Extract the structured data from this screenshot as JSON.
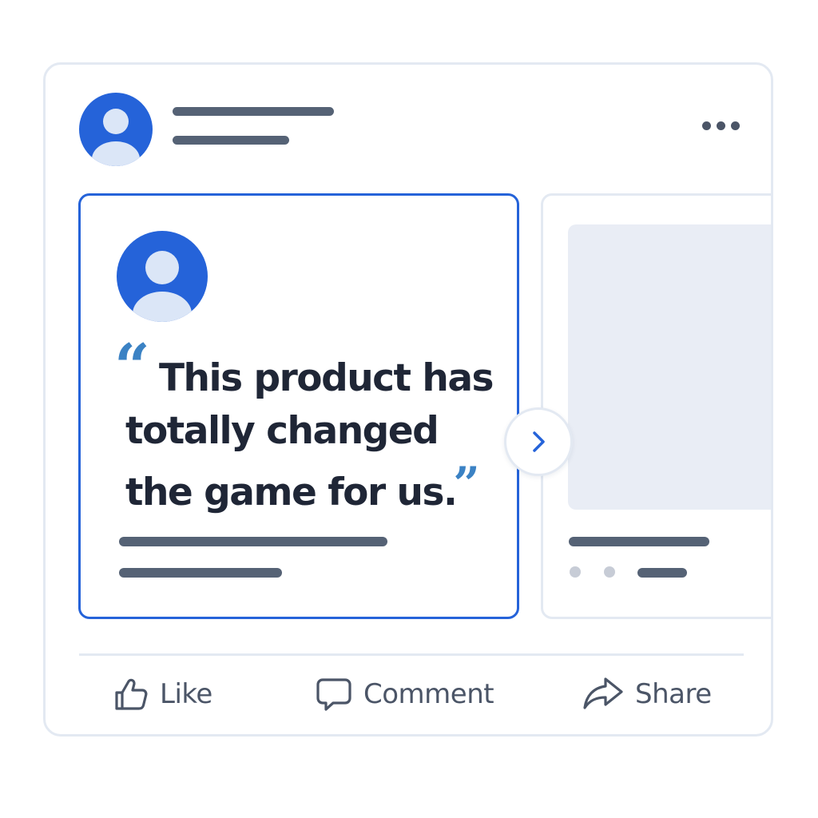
{
  "post": {
    "menu_icon": "more-horizontal-icon"
  },
  "carousel": {
    "testimonial": {
      "quote": {
        "open_mark": "“",
        "line1": "This product has",
        "line2": "totally changed",
        "line3": "the game for us.",
        "close_mark": "”"
      }
    },
    "next_icon": "chevron-right-icon"
  },
  "actions": {
    "like": {
      "label": "Like",
      "icon": "thumbs-up-icon"
    },
    "comment": {
      "label": "Comment",
      "icon": "speech-bubble-icon"
    },
    "share": {
      "label": "Share",
      "icon": "share-arrow-icon"
    }
  },
  "colors": {
    "accent": "#2563d9",
    "quote_mark": "#3b82c4",
    "avatar_light": "#dbe6f7",
    "text_dark": "#1f2636",
    "text_muted": "#4b5567",
    "placeholder_bar": "#556275",
    "border": "#e3e9f2"
  }
}
